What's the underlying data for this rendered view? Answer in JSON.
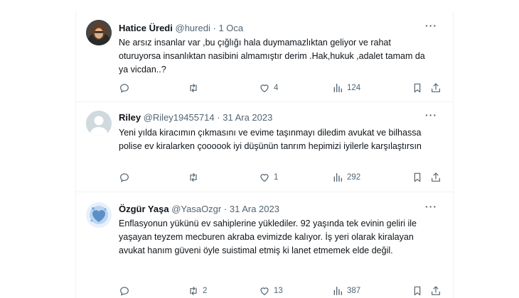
{
  "tweets": [
    {
      "name": "Hatice Üredi",
      "handle": "@huredi",
      "sep": "·",
      "date": "1 Oca",
      "more": "···",
      "text": "Ne arsız insanlar var ,bu çığlığı hala duymamazlıktan geliyor ve rahat oturuyorsa insanlıktan nasibini almamıştır derim .Hak,hukuk  ,adalet tamam da ya vicdan..?",
      "replies": "",
      "reposts": "",
      "likes": "4",
      "views": "124"
    },
    {
      "name": "Riley",
      "handle": "@Riley19455714",
      "sep": "·",
      "date": "31 Ara 2023",
      "more": "···",
      "text": "Yeni yılda kiracımın çıkmasını ve evime taşınmayı diledim avukat ve bilhassa polise ev kiralarken çoooook iyi düşünün tanrım hepimizi iyilerle karşılaştırsın",
      "replies": "",
      "reposts": "",
      "likes": "1",
      "views": "292"
    },
    {
      "name": "Özgür Yaşa",
      "handle": "@YasaOzgr",
      "sep": "·",
      "date": "31 Ara 2023",
      "more": "···",
      "text": "Enflasyonun yükünü ev sahiplerine yüklediler. 92 yaşında tek evinin geliri ile yaşayan teyzem mecburen akraba evimizde kalıyor. İş yeri olarak kiralayan avukat hanım güveni öyle suistimal etmiş ki lanet etmemek elde değil.",
      "replies": "",
      "reposts": "2",
      "likes": "13",
      "views": "387"
    }
  ],
  "colors": {
    "text": "#0f1419",
    "muted": "#536471",
    "border": "#eff3f4"
  }
}
